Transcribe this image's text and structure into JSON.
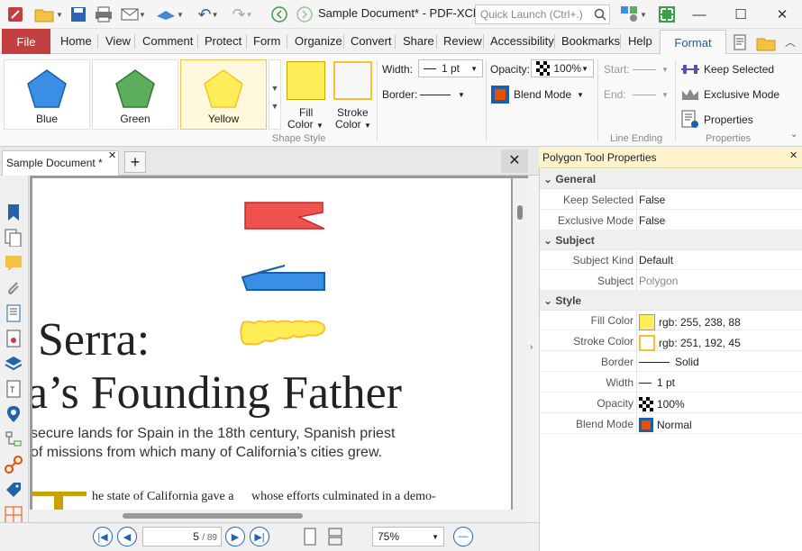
{
  "app": {
    "doc_title": "Sample Document* - PDF-XCh..",
    "quick_launch_placeholder": "Quick Launch (Ctrl+.)"
  },
  "menu": {
    "file": "File",
    "tabs": [
      "Home",
      "View",
      "Comment",
      "Protect",
      "Form",
      "Organize",
      "Convert",
      "Share",
      "Review",
      "Accessibility",
      "Bookmarks",
      "Help"
    ],
    "active": "Format"
  },
  "ribbon": {
    "shapes": [
      {
        "label": "Blue",
        "color": "#3a8ee6"
      },
      {
        "label": "Green",
        "color": "#5cae5c"
      },
      {
        "label": "Yellow",
        "color": "#ffee58"
      }
    ],
    "fill_label": "Fill",
    "fill_sub": "Color",
    "stroke_label": "Stroke",
    "stroke_sub": "Color",
    "shape_style_group": "Shape Style",
    "width_label": "Width:",
    "width_value": "1 pt",
    "border_label": "Border:",
    "opacity_label": "Opacity:",
    "opacity_value": "100%",
    "blend_mode": "Blend Mode",
    "start_label": "Start:",
    "end_label": "End:",
    "line_ending_group": "Line Ending",
    "keep_selected": "Keep Selected",
    "exclusive_mode": "Exclusive Mode",
    "properties": "Properties",
    "properties_group": "Properties"
  },
  "doc_tab": {
    "label": "Sample Document *"
  },
  "page": {
    "line1": "Serra:",
    "line2": "a’s Founding Father",
    "sub1": "secure lands for Spain in the 18th century, Spanish priest",
    "sub2": "of missions from which many of California’s cities grew.",
    "body_a": "he state of California gave a",
    "body_b": "whose efforts culminated in a demo-"
  },
  "nav": {
    "page_current": "5",
    "page_total": "/ 89",
    "zoom": "75%"
  },
  "panel": {
    "title": "Polygon Tool Properties",
    "sections": [
      {
        "name": "General",
        "rows": [
          {
            "key": "Keep Selected",
            "value": "False"
          },
          {
            "key": "Exclusive Mode",
            "value": "False"
          }
        ]
      },
      {
        "name": "Subject",
        "rows": [
          {
            "key": "Subject Kind",
            "value": "Default"
          },
          {
            "key": "Subject",
            "value": "Polygon"
          }
        ]
      },
      {
        "name": "Style",
        "rows": [
          {
            "key": "Fill Color",
            "value": "rgb: 255, 238, 88"
          },
          {
            "key": "Stroke Color",
            "value": "rgb: 251, 192, 45"
          },
          {
            "key": "Border",
            "value": "Solid"
          },
          {
            "key": "Width",
            "value": "1 pt"
          },
          {
            "key": "Opacity",
            "value": "100%"
          },
          {
            "key": "Blend Mode",
            "value": "Normal"
          }
        ]
      }
    ]
  },
  "colors": {
    "fill": "#ffee58",
    "stroke": "#fbc02d",
    "file_tab": "#c33e3e",
    "accent": "#1a5fa8"
  }
}
